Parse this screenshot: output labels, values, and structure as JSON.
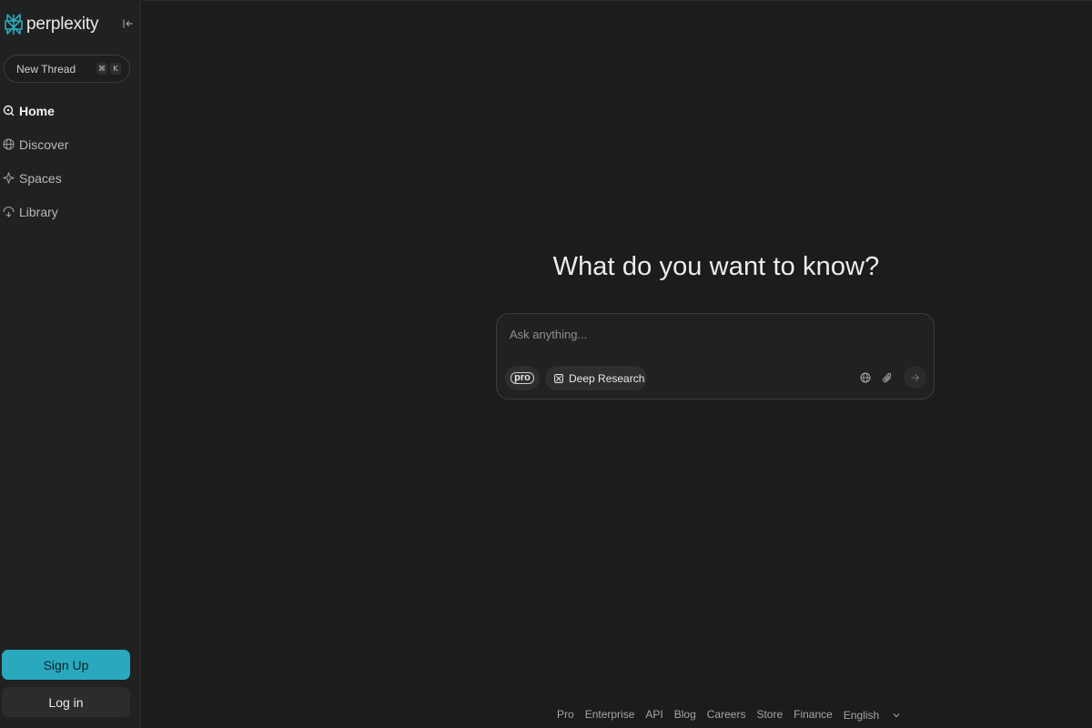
{
  "brand": {
    "name": "perplexity",
    "accent": "#2aa9be"
  },
  "sidebar": {
    "new_thread": {
      "label": "New Thread",
      "kbd": [
        "⌘",
        "K"
      ]
    },
    "items": [
      {
        "label": "Home",
        "icon": "search-icon",
        "active": true
      },
      {
        "label": "Discover",
        "icon": "globe-icon",
        "active": false
      },
      {
        "label": "Spaces",
        "icon": "sparkle-icon",
        "active": false
      },
      {
        "label": "Library",
        "icon": "library-icon",
        "active": false
      }
    ],
    "signup_label": "Sign Up",
    "login_label": "Log in"
  },
  "main": {
    "heading": "What do you want to know?",
    "ask": {
      "placeholder": "Ask anything...",
      "pro_label": "pro",
      "deep_research_label": "Deep Research"
    }
  },
  "footer": {
    "links": [
      "Pro",
      "Enterprise",
      "API",
      "Blog",
      "Careers",
      "Store",
      "Finance"
    ],
    "language": "English"
  }
}
